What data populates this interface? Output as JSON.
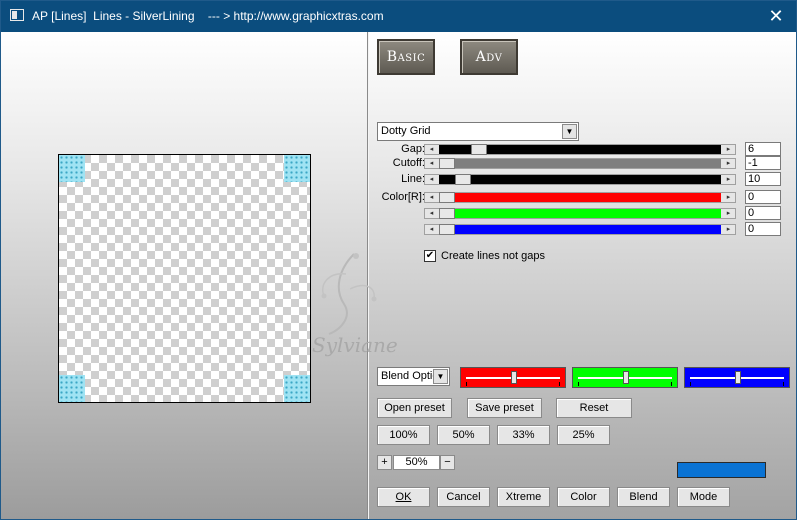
{
  "window": {
    "title": "AP [Lines]  Lines - SilverLining    --- > http://www.graphicxtras.com",
    "close_glyph": "✕"
  },
  "tabs": {
    "basic": "Basic",
    "adv": "Adv"
  },
  "preset_dropdown": {
    "value": "Dotty Grid"
  },
  "sliders": [
    {
      "label": "Gap:",
      "value": "6",
      "thumb_pos": 0.12,
      "color": "#000000"
    },
    {
      "label": "Cutoff:",
      "value": "-1",
      "thumb_pos": 0.0,
      "color": "#7f7f7f"
    },
    {
      "label": "Line:",
      "value": "10",
      "thumb_pos": 0.06,
      "color": "#000000"
    },
    {
      "label": "Color[R]:",
      "value": "0",
      "thumb_pos": 0.0,
      "color": "#ff0000"
    },
    {
      "label": "",
      "value": "0",
      "thumb_pos": 0.0,
      "color": "#00ff00"
    },
    {
      "label": "",
      "value": "0",
      "thumb_pos": 0.0,
      "color": "#0000ff"
    }
  ],
  "checkbox": {
    "label": "Create lines not gaps",
    "checked": true,
    "glyph": "✔"
  },
  "blend": {
    "dropdown_value": "Blend Optio",
    "colors": [
      "#ff0000",
      "#00ff00",
      "#0000ff"
    ],
    "levels": [
      0.5,
      0.5,
      0.5
    ]
  },
  "buttons": {
    "open_preset": "Open preset",
    "save_preset": "Save preset",
    "reset": "Reset",
    "p100": "100%",
    "p50": "50%",
    "p33": "33%",
    "p25": "25%",
    "ok": "OK",
    "cancel": "Cancel",
    "xtreme": "Xtreme",
    "color": "Color",
    "blend": "Blend",
    "mode": "Mode"
  },
  "zoom": {
    "plus": "+",
    "minus": "−",
    "value": "50%"
  },
  "swatch_color": "#0a73d4",
  "watermark": {
    "text": "Sylviane"
  },
  "arrows": {
    "left": "◂",
    "right": "▸",
    "down": "▼"
  }
}
